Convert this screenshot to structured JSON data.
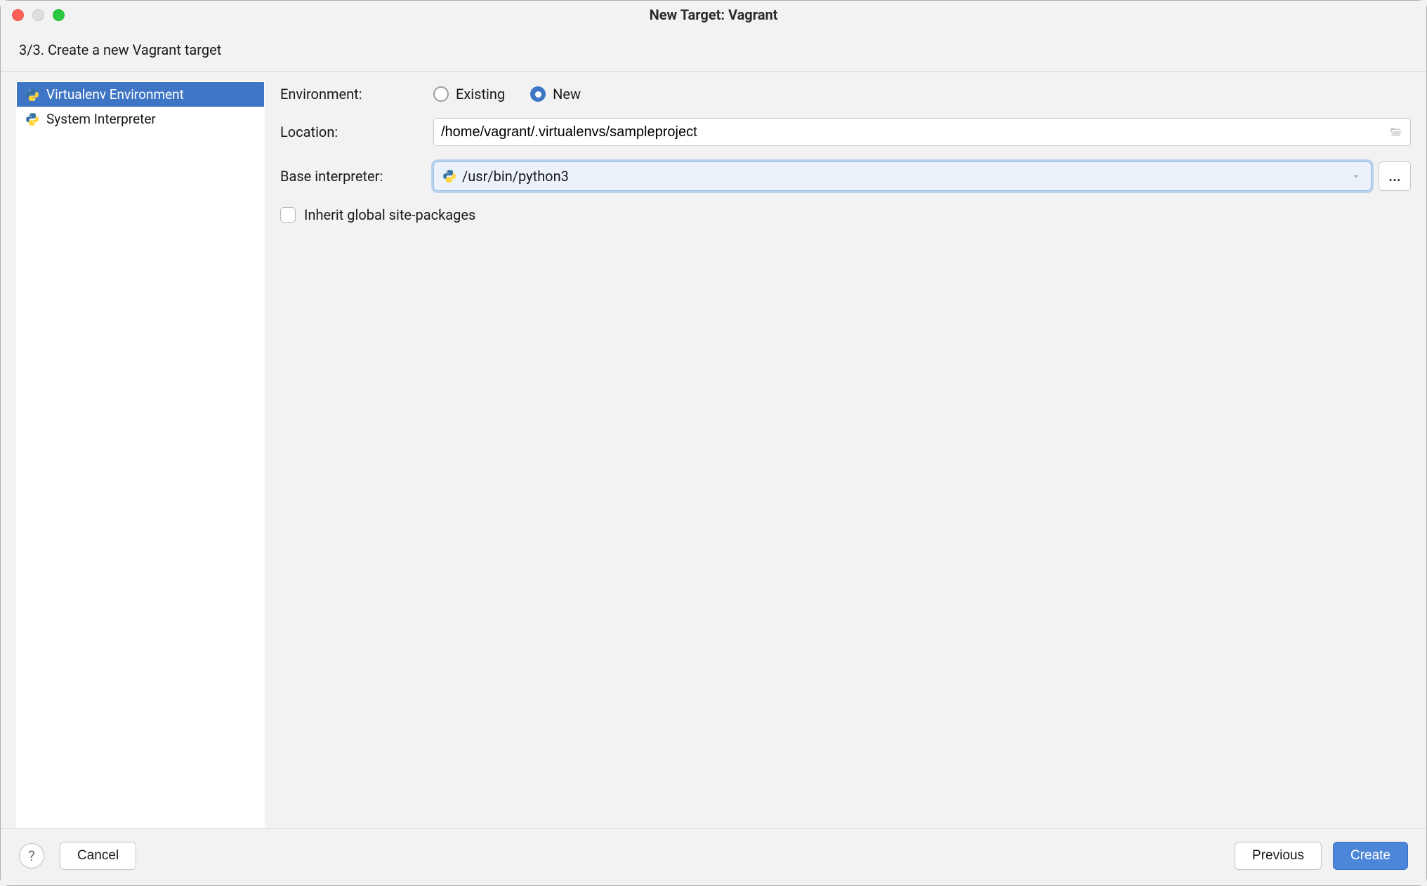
{
  "window": {
    "title": "New Target: Vagrant"
  },
  "step": {
    "text": "3/3. Create a new Vagrant target"
  },
  "sidebar": {
    "items": [
      {
        "label": "Virtualenv Environment",
        "selected": true
      },
      {
        "label": "System Interpreter",
        "selected": false
      }
    ]
  },
  "form": {
    "environment_label": "Environment:",
    "radio_existing": "Existing",
    "radio_new": "New",
    "location_label": "Location:",
    "location_value": "/home/vagrant/.virtualenvs/sampleproject",
    "base_interpreter_label": "Base interpreter:",
    "base_interpreter_value": "/usr/bin/python3",
    "more_btn": "...",
    "inherit_label": "Inherit global site-packages"
  },
  "footer": {
    "help": "?",
    "cancel": "Cancel",
    "previous": "Previous",
    "create": "Create"
  }
}
